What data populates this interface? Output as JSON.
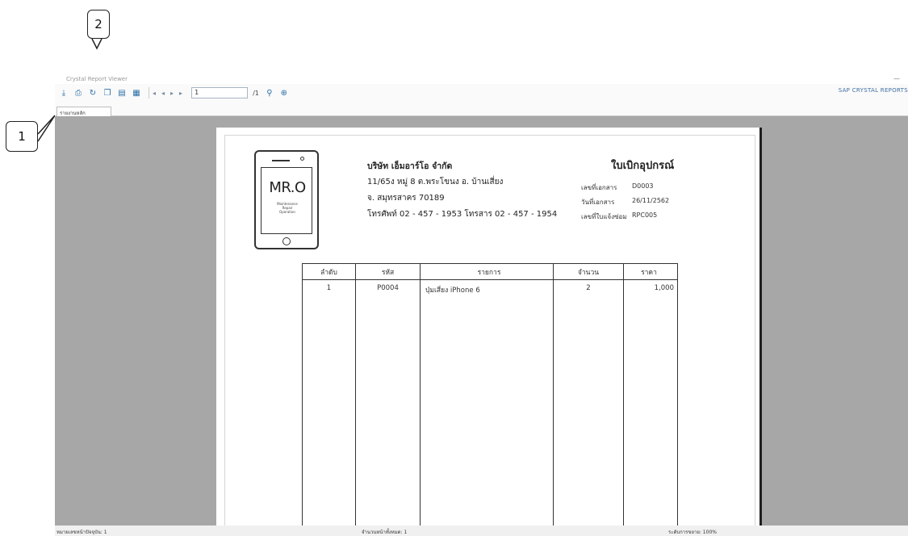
{
  "callouts": {
    "one": "1",
    "two": "2"
  },
  "window": {
    "title": "Crystal Report Viewer",
    "minimize": "—"
  },
  "toolbar": {
    "icons": [
      "export-icon",
      "print-icon",
      "refresh-icon",
      "copy-icon",
      "toggle-group-tree-icon",
      "toggle-parameter-panel-icon",
      "first-page-icon",
      "previous-page-icon",
      "next-page-icon",
      "last-page-icon",
      "search-icon",
      "zoom-icon"
    ],
    "page_number": "1",
    "page_total": "/1",
    "brand": "SAP CRYSTAL REPORTS"
  },
  "tab": {
    "label": "รายงานหลัก"
  },
  "report": {
    "logo": {
      "text": "MR.O",
      "tagline_1": "Maintenance",
      "tagline_2": "Repair",
      "tagline_3": "Operation"
    },
    "company_name": "บริษัท เอ็มอาร์โอ จำกัด",
    "address_1": "11/65ง หมู่ 8 ต.พระโขนง อ. บ้านเสี่ยง",
    "address_2": "จ. สมุทรสาคร 70189",
    "contact": "โทรศัพท์ 02 - 457 - 1953 โทรสาร 02 - 457 - 1954",
    "doc_title": "ใบเบิกอุปกรณ์",
    "meta": [
      {
        "label": "เลขที่เอกสาร",
        "value": "D0003"
      },
      {
        "label": "วันที่เอกสาร",
        "value": "26/11/2562"
      },
      {
        "label": "เลขที่ใบแจ้งซ่อม",
        "value": "RPC005"
      }
    ],
    "table": {
      "headers": [
        "ลำดับ",
        "รหัส",
        "รายการ",
        "จำนวน",
        "ราคา"
      ],
      "rows": [
        {
          "no": "1",
          "code": "P0004",
          "item": "ปุ่มเสี่ยง iPhone 6",
          "qty": "2",
          "price": "1,000"
        }
      ]
    }
  },
  "status": {
    "current_page": "หมายเลขหน้าปัจจุบัน: 1",
    "total_pages": "จำนวนหน้าทั้งหมด: 1",
    "zoom": "ระดับการขยาย: 100%"
  }
}
